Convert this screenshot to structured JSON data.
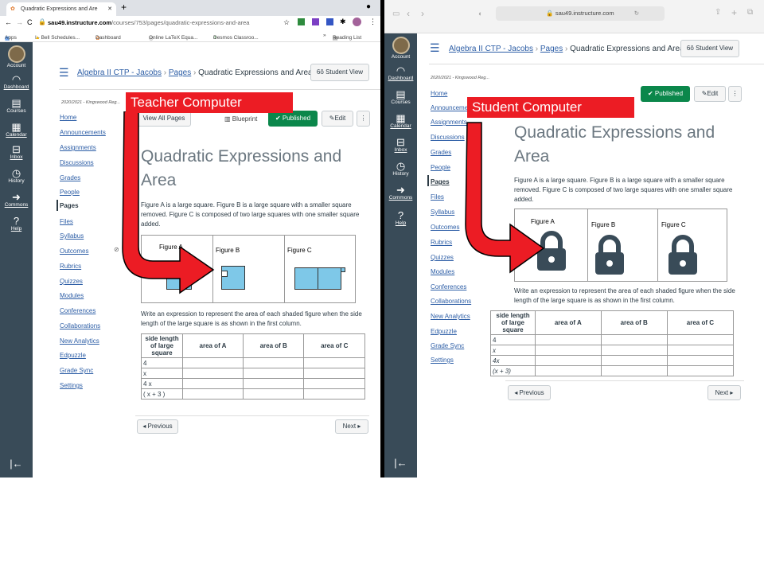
{
  "teacher": {
    "tab_title": "Quadratic Expressions and Are",
    "url_host": "sau49.instructure.com",
    "url_path": "/courses/753/pages/quadratic-expressions-and-area",
    "bookmarks": [
      "Apps",
      "I - Bell Schedules...",
      "Dashboard",
      "Online LaTeX Equa...",
      "Desmos Classroo..."
    ],
    "reading_list": "Reading List",
    "global_nav": [
      "Account",
      "Dashboard",
      "Courses",
      "Calendar",
      "Inbox",
      "History",
      "Commons",
      "Help"
    ],
    "breadcrumb": [
      "Algebra II CTP - Jacobs",
      "Pages",
      "Quadratic Expressions and Area"
    ],
    "student_view": "Student View",
    "term": "2020/2021 - Kingswood Reg...",
    "course_nav": [
      "Home",
      "Announcements",
      "Assignments",
      "Discussions",
      "Grades",
      "People",
      "Pages",
      "Files",
      "Syllabus",
      "Outcomes",
      "Rubrics",
      "Quizzes",
      "Modules",
      "Conferences",
      "Collaborations",
      "New Analytics",
      "Edpuzzle",
      "Grade Sync",
      "Settings"
    ],
    "view_all": "View All Pages",
    "blueprint": "Blueprint",
    "published": "Published",
    "edit": "Edit",
    "page_title": "Quadratic Expressions and Area",
    "body": "Figure A is a large square. Figure B is a large square with a smaller square removed. Figure C is composed of two large squares with one smaller square added.",
    "figures": [
      "Figure A",
      "Figure B",
      "Figure C"
    ],
    "prompt": "Write an expression to represent the area of each shaded figure when the side length of the large square is as shown in the first column.",
    "table_headers": [
      "side length of large square",
      "area of A",
      "area of B",
      "area of C"
    ],
    "table_rows": [
      "4",
      "x",
      "4 x",
      "( x + 3 )"
    ],
    "prev": "◂ Previous",
    "next": "Next ▸",
    "callout": "Teacher Computer"
  },
  "student": {
    "url": "sau49.instructure.com",
    "global_nav": [
      "Account",
      "Dashboard",
      "Courses",
      "Calendar",
      "Inbox",
      "History",
      "Commons",
      "Help"
    ],
    "breadcrumb": [
      "Algebra II CTP - Jacobs",
      "Pages",
      "Quadratic Expressions and Area"
    ],
    "student_view": "Student View",
    "term": "2020/2021 - Kingswood Reg...",
    "course_nav": [
      "Home",
      "Announcements",
      "Assignments",
      "Discussions",
      "Grades",
      "People",
      "Pages",
      "Files",
      "Syllabus",
      "Outcomes",
      "Rubrics",
      "Quizzes",
      "Modules",
      "Conferences",
      "Collaborations",
      "New Analytics",
      "Edpuzzle",
      "Grade Sync",
      "Settings"
    ],
    "published": "Published",
    "edit": "Edit",
    "page_title": "Quadratic Expressions and Area",
    "body": "Figure A is a large square. Figure B is a large square with a smaller square removed. Figure C is composed of two large squares with one smaller square added.",
    "figures": [
      "Figure A",
      "Figure B",
      "Figure C"
    ],
    "prompt": "Write an expression to represent the area of each shaded figure when the side length of the large square is as shown in the first column.",
    "table_headers": [
      "side length of large square",
      "area of A",
      "area of B",
      "area of C"
    ],
    "table_rows": [
      "4",
      "x",
      "4x",
      "(x + 3)"
    ],
    "prev": "◂ Previous",
    "next": "Next ▸",
    "callout": "Student Computer"
  },
  "colors": {
    "callout_red": "#ec1c24",
    "canvas_nav": "#394b58",
    "published_green": "#0b874b",
    "link_blue": "#2d5ea6",
    "figure_fill": "#7ec8e8"
  }
}
